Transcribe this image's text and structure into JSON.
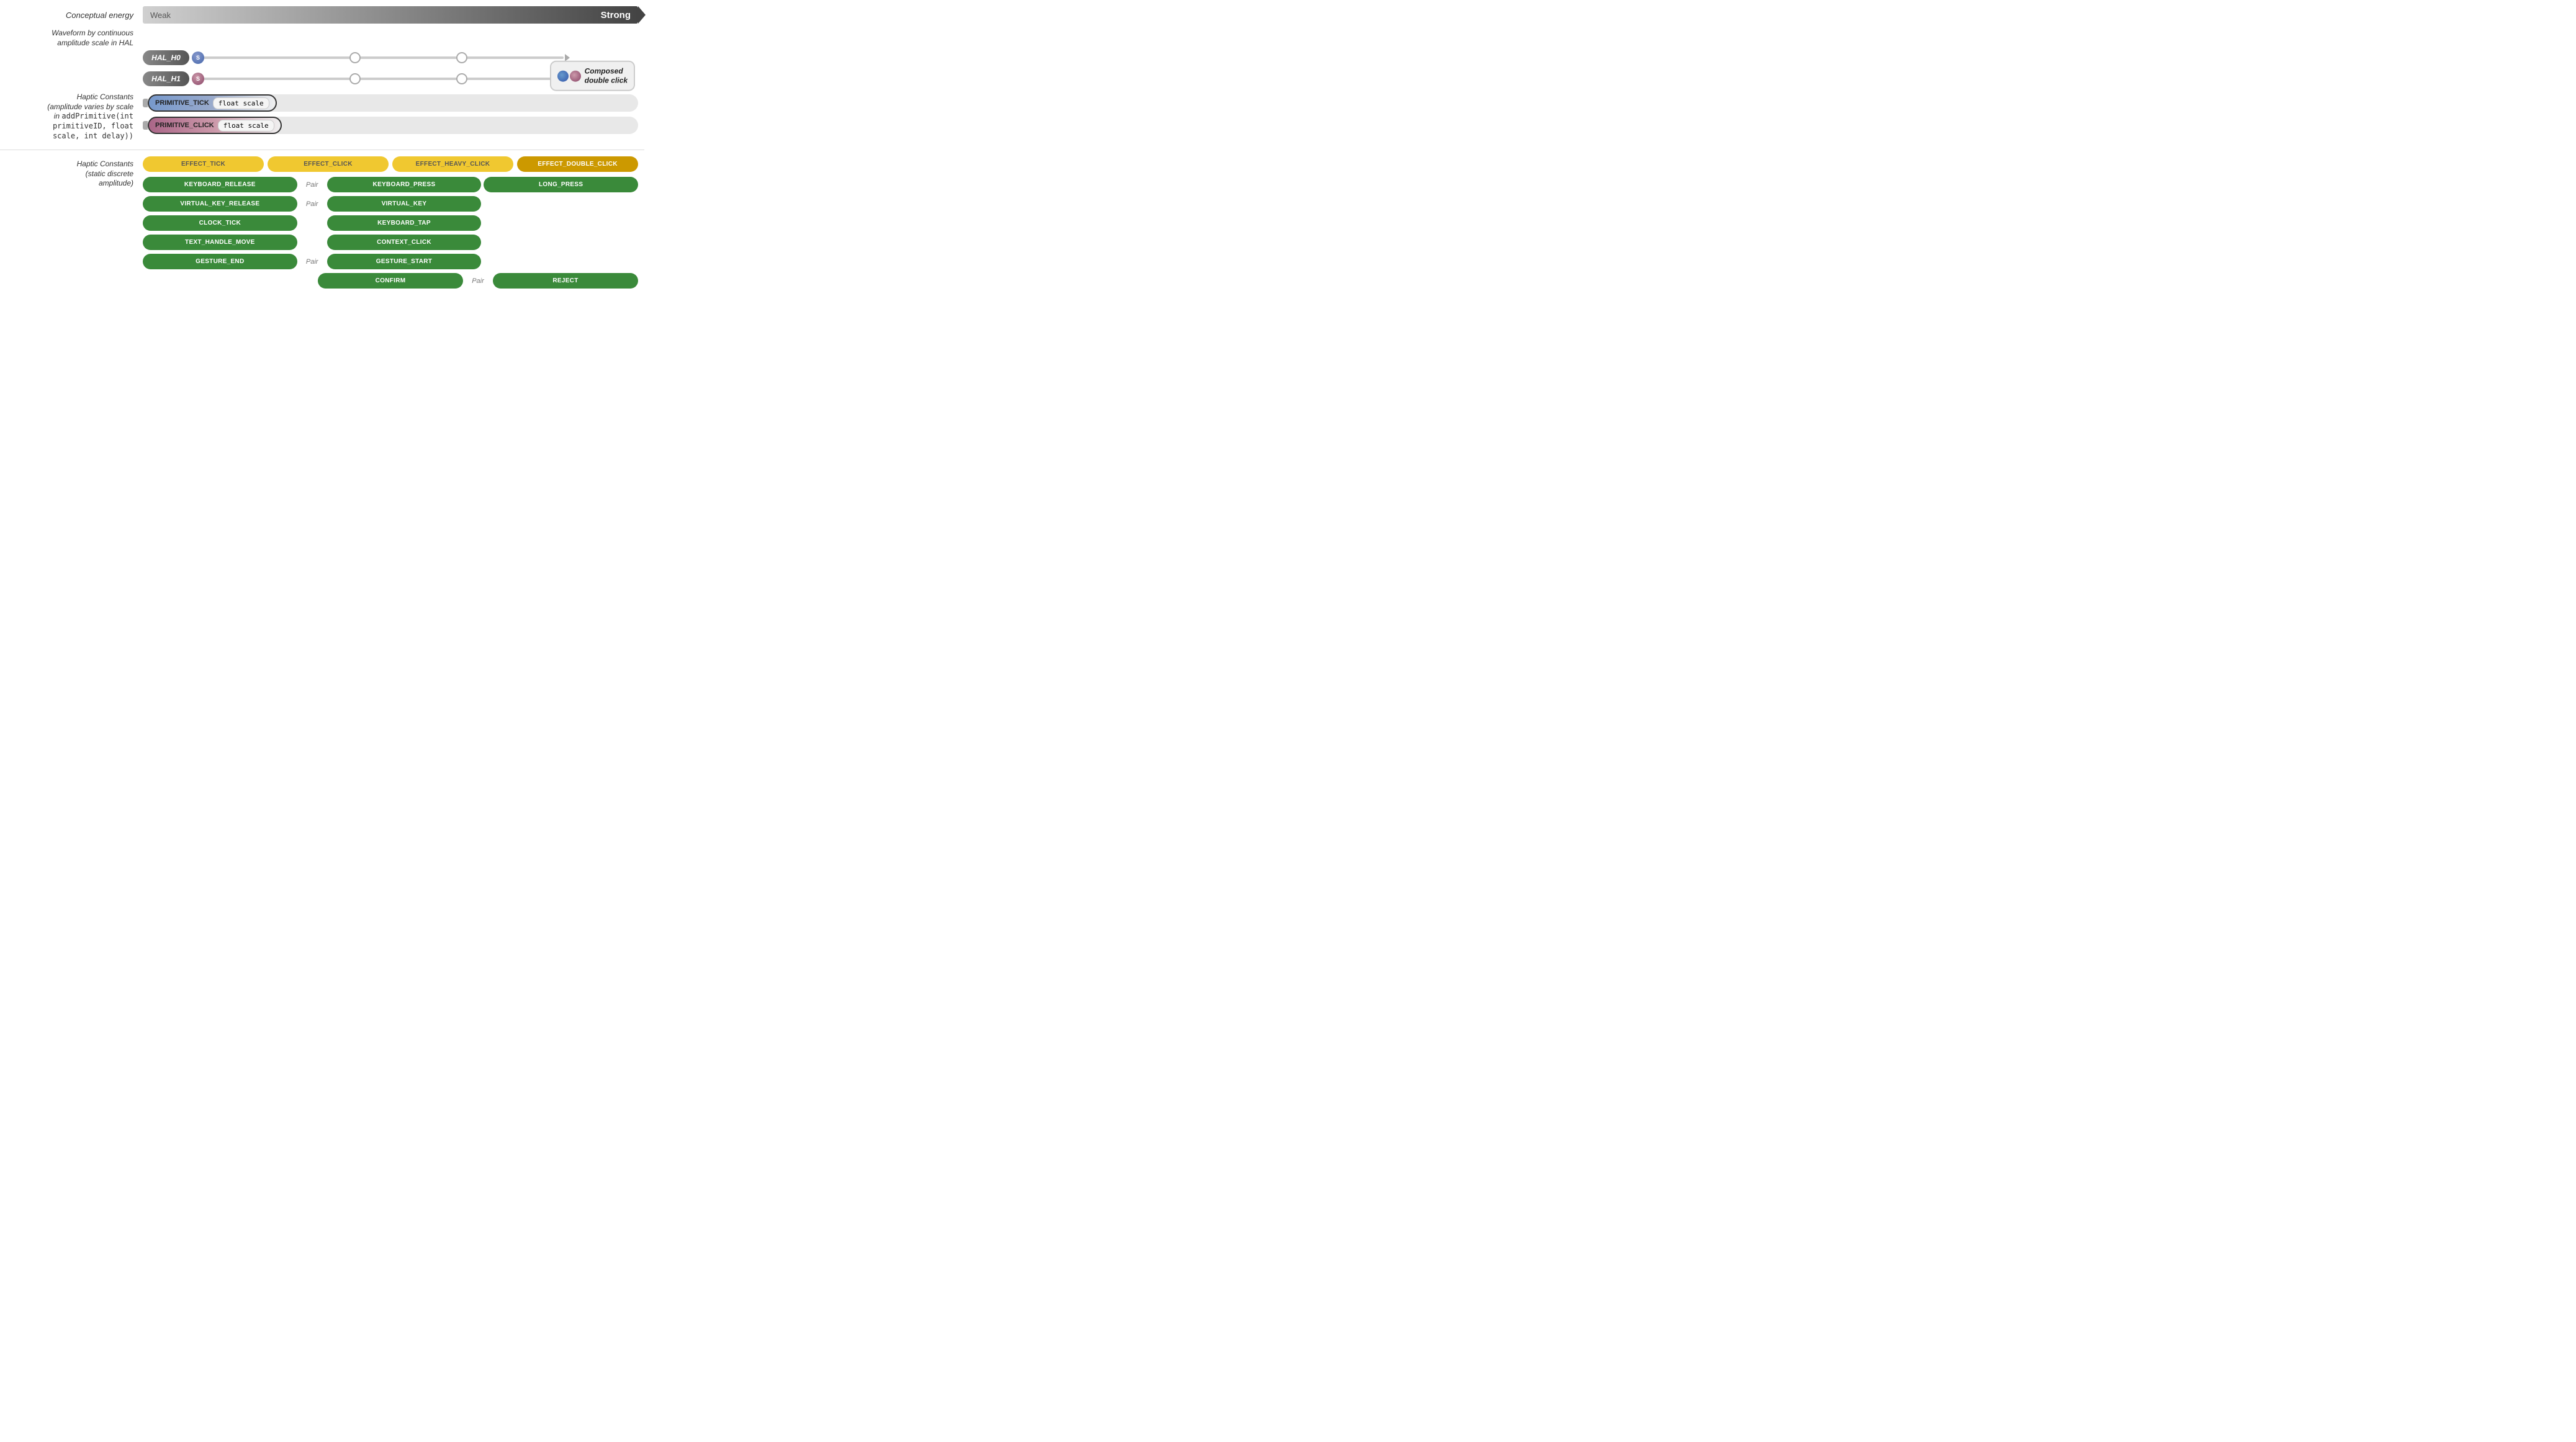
{
  "conceptual_energy": {
    "label": "Conceptual energy",
    "weak": "Weak",
    "strong": "Strong"
  },
  "waveform_label": {
    "text": "Waveform by continuous\namplitude scale in HAL"
  },
  "hal_sliders": [
    {
      "id": "HAL_H0",
      "label": "HAL_H0",
      "dot_color": "blue",
      "dot_label": "S",
      "mid1_pos": "43%",
      "mid2_pos": "73%"
    },
    {
      "id": "HAL_H1",
      "label": "HAL_H1",
      "dot_color": "pink",
      "dot_label": "S",
      "mid1_pos": "43%",
      "mid2_pos": "73%"
    }
  ],
  "composed_badge": {
    "text": "Composed\ndouble click"
  },
  "primitive_label": "Haptic Constants\n(amplitude varies by scale\nin addPrimitive(int\nprimitiveID, float\nscale, int delay))",
  "primitives": [
    {
      "id": "PRIMITIVE_TICK",
      "name": "PRIMITIVE_TICK",
      "scale_label": "float scale",
      "type": "tick"
    },
    {
      "id": "PRIMITIVE_CLICK",
      "name": "PRIMITIVE_CLICK",
      "scale_label": "float scale",
      "type": "click"
    }
  ],
  "discrete_label": "Haptic Constants\n(static discrete\namplitude)",
  "effects": {
    "row1": [
      {
        "id": "EFFECT_TICK",
        "label": "EFFECT_TICK",
        "style": "yellow",
        "col": 1
      },
      {
        "id": "EFFECT_CLICK",
        "label": "EFFECT_CLICK",
        "style": "yellow",
        "col": 2
      },
      {
        "id": "EFFECT_HEAVY_CLICK",
        "label": "EFFECT_HEAVY_CLICK",
        "style": "yellow",
        "col": 3
      },
      {
        "id": "EFFECT_DOUBLE_CLICK",
        "label": "EFFECT_DOUBLE_CLICK",
        "style": "yellow_dark",
        "col": 4
      }
    ],
    "pairs": [
      {
        "left": "KEYBOARD_RELEASE",
        "pair_label": "Pair",
        "right": "KEYBOARD_PRESS",
        "extra": "LONG_PRESS"
      },
      {
        "left": "VIRTUAL_KEY_RELEASE",
        "pair_label": "Pair",
        "right": "VIRTUAL_KEY",
        "extra": ""
      },
      {
        "left": "CLOCK_TICK",
        "pair_label": "",
        "right": "KEYBOARD_TAP",
        "extra": ""
      },
      {
        "left": "TEXT_HANDLE_MOVE",
        "pair_label": "",
        "right": "CONTEXT_CLICK",
        "extra": ""
      },
      {
        "left": "GESTURE_END",
        "pair_label": "Pair",
        "right": "GESTURE_START",
        "extra": ""
      },
      {
        "left": "",
        "pair_label": "",
        "right": "CONFIRM",
        "extra_pair_label": "Pair",
        "extra": "REJECT"
      }
    ]
  }
}
